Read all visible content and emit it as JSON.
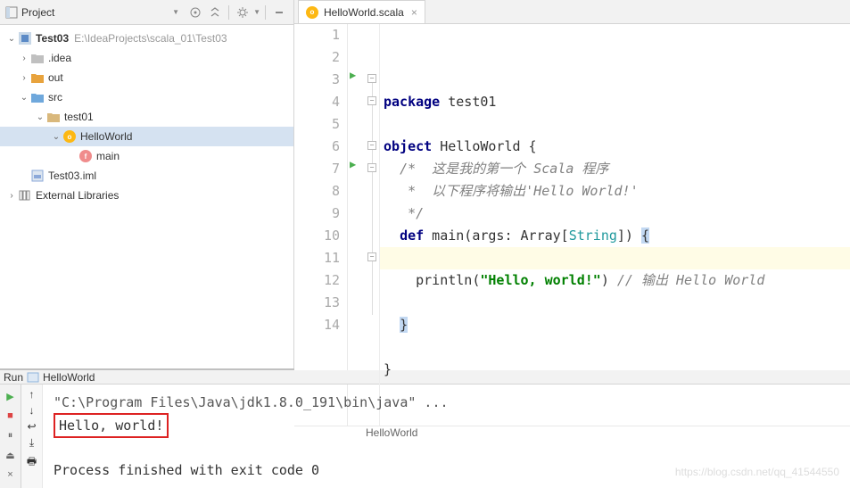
{
  "sidebar": {
    "title": "Project",
    "project": {
      "name": "Test03",
      "path": "E:\\IdeaProjects\\scala_01\\Test03"
    },
    "idea": ".idea",
    "out": "out",
    "src": "src",
    "pkg": "test01",
    "file": "HelloWorld",
    "fn": "main",
    "iml": "Test03.iml",
    "ext": "External Libraries"
  },
  "tab": {
    "name": "HelloWorld.scala"
  },
  "code": {
    "l1_kw": "package",
    "l1_rest": " test01",
    "l3_kw": "object",
    "l3_rest": " HelloWorld {",
    "l4": "/*  这是我的第一个 Scala 程序",
    "l5": " *  以下程序将输出'Hello World!'",
    "l6": " */",
    "l7_kw": "def",
    "l7_mid": " main(args: Array[",
    "l7_type": "String",
    "l7_end": "]) ",
    "l7_brace": "{",
    "l9_a": "  println(",
    "l9_str": "\"Hello, world!\"",
    "l9_b": ") ",
    "l9_com": "// 输出 Hello World",
    "l11": "}",
    "l13": "}"
  },
  "gutter": [
    "1",
    "2",
    "3",
    "4",
    "5",
    "6",
    "7",
    "8",
    "9",
    "10",
    "11",
    "12",
    "13",
    "14"
  ],
  "breadcrumb": "HelloWorld",
  "run": {
    "title": "Run",
    "config": "HelloWorld",
    "cmd": "\"C:\\Program Files\\Java\\jdk1.8.0_191\\bin\\java\" ...",
    "output": "Hello, world!",
    "exit": "Process finished with exit code 0"
  },
  "watermark": "https://blog.csdn.net/qq_41544550"
}
